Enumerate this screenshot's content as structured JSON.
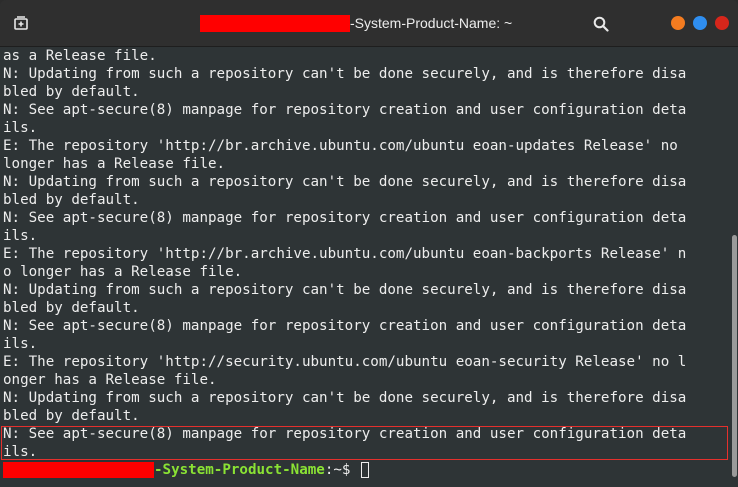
{
  "window": {
    "title_suffix": "-System-Product-Name: ~"
  },
  "icons": {
    "new_tab": "new-tab-icon",
    "search": "search-icon",
    "minimize": "minimize-icon",
    "maximize": "maximize-icon",
    "close": "close-icon"
  },
  "colors": {
    "title_bg": "#2f2f2f",
    "terminal_bg": "#2e3436",
    "text": "#ededed",
    "prompt_green": "#8ae234",
    "redaction": "#ff0000",
    "minimize": "#f47c20",
    "maximize": "#2f8ef0",
    "close": "#d7261b",
    "highlight_border": "#e5302d"
  },
  "terminal": {
    "lines": [
      "as a Release file.",
      "N: Updating from such a repository can't be done securely, and is therefore disa",
      "bled by default.",
      "N: See apt-secure(8) manpage for repository creation and user configuration deta",
      "ils.",
      "E: The repository 'http://br.archive.ubuntu.com/ubuntu eoan-updates Release' no",
      "longer has a Release file.",
      "N: Updating from such a repository can't be done securely, and is therefore disa",
      "bled by default.",
      "N: See apt-secure(8) manpage for repository creation and user configuration deta",
      "ils.",
      "E: The repository 'http://br.archive.ubuntu.com/ubuntu eoan-backports Release' n",
      "o longer has a Release file.",
      "N: Updating from such a repository can't be done securely, and is therefore disa",
      "bled by default.",
      "N: See apt-secure(8) manpage for repository creation and user configuration deta",
      "ils.",
      "E: The repository 'http://security.ubuntu.com/ubuntu eoan-security Release' no l",
      "onger has a Release file.",
      "N: Updating from such a repository can't be done securely, and is therefore disa",
      "bled by default.",
      "N: See apt-secure(8) manpage for repository creation and user configuration deta",
      "ils."
    ],
    "prompt": {
      "host_suffix": "-System-Product-Name",
      "path": ":~$ "
    }
  }
}
